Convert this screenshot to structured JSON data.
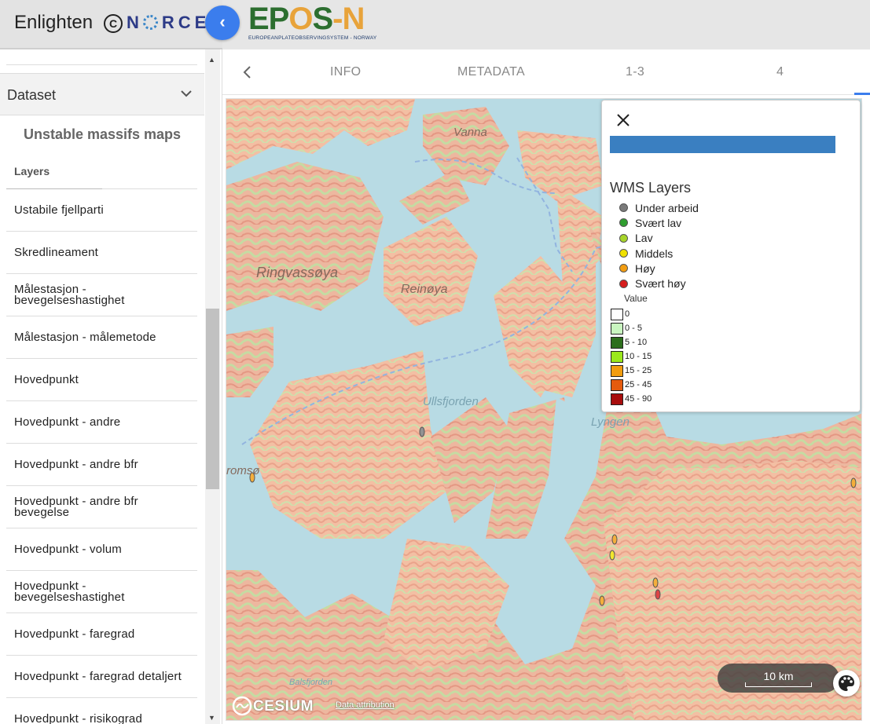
{
  "header": {
    "app_title": "Enlighten",
    "copyright_symbol": "C",
    "org_name": "RCE",
    "collapse_icon": "chevron-left-icon",
    "logo_word": {
      "ep": "EP",
      "o": "O",
      "s": "S",
      "dash": "-",
      "n": "N"
    },
    "logo_subtitle": "EUROPEANPLATEOBSERVINGSYSTEM  -  NORWAY"
  },
  "sidebar": {
    "dataset_label": "Dataset",
    "section_title": "Unstable massifs maps",
    "layers_heading": "Layers",
    "layers": [
      {
        "line1": "Ustabile fjellparti",
        "line2": ""
      },
      {
        "line1": "Skredlineament",
        "line2": ""
      },
      {
        "line1": "Målestasjon -",
        "line2": "bevegelseshastighet"
      },
      {
        "line1": "Målestasjon - målemetode",
        "line2": ""
      },
      {
        "line1": "Hovedpunkt",
        "line2": ""
      },
      {
        "line1": "Hovedpunkt - andre",
        "line2": ""
      },
      {
        "line1": "Hovedpunkt - andre bfr",
        "line2": ""
      },
      {
        "line1": "Hovedpunkt - andre bfr",
        "line2": "bevegelse"
      },
      {
        "line1": "Hovedpunkt - volum",
        "line2": ""
      },
      {
        "line1": "Hovedpunkt -",
        "line2": "bevegelseshastighet"
      },
      {
        "line1": "Hovedpunkt - faregrad",
        "line2": ""
      },
      {
        "line1": "Hovedpunkt - faregrad detaljert",
        "line2": ""
      },
      {
        "line1": "Hovedpunkt - risikograd",
        "line2": ""
      }
    ]
  },
  "tabs": [
    {
      "label": "INFO"
    },
    {
      "label": "METADATA"
    },
    {
      "label": "1-3"
    },
    {
      "label": "4"
    }
  ],
  "map": {
    "place_labels": [
      "Vanna",
      "Ringvassøya",
      "Reinøya",
      "Ullsfjorden",
      "Lyngen",
      "romsø",
      "Balsfjorden"
    ],
    "scale_label": "10 km",
    "attribution": "Data attribution",
    "cesium_label": "CESIUM"
  },
  "legend": {
    "close_icon": "close-icon",
    "bar_color": "#3a7fc1",
    "title": "WMS Layers",
    "wms_items": [
      {
        "label": "Under arbeid",
        "color": "#7a7a7a"
      },
      {
        "label": "Svært lav",
        "color": "#2f9e2f"
      },
      {
        "label": "Lav",
        "color": "#a7d52a"
      },
      {
        "label": "Middels",
        "color": "#f0e100"
      },
      {
        "label": "Høy",
        "color": "#f29d12"
      },
      {
        "label": "Svært høy",
        "color": "#d61d1d"
      }
    ],
    "value_title": "Value",
    "value_items": [
      {
        "label": "0",
        "color": "#ffffff"
      },
      {
        "label": "0 - 5",
        "color": "#c9f5c0"
      },
      {
        "label": "5 - 10",
        "color": "#2c6e1c"
      },
      {
        "label": "10 - 15",
        "color": "#9be81d"
      },
      {
        "label": "15 - 25",
        "color": "#f19d10"
      },
      {
        "label": "25 - 45",
        "color": "#e55b0e"
      },
      {
        "label": "45 - 90",
        "color": "#a80d0d"
      }
    ]
  }
}
